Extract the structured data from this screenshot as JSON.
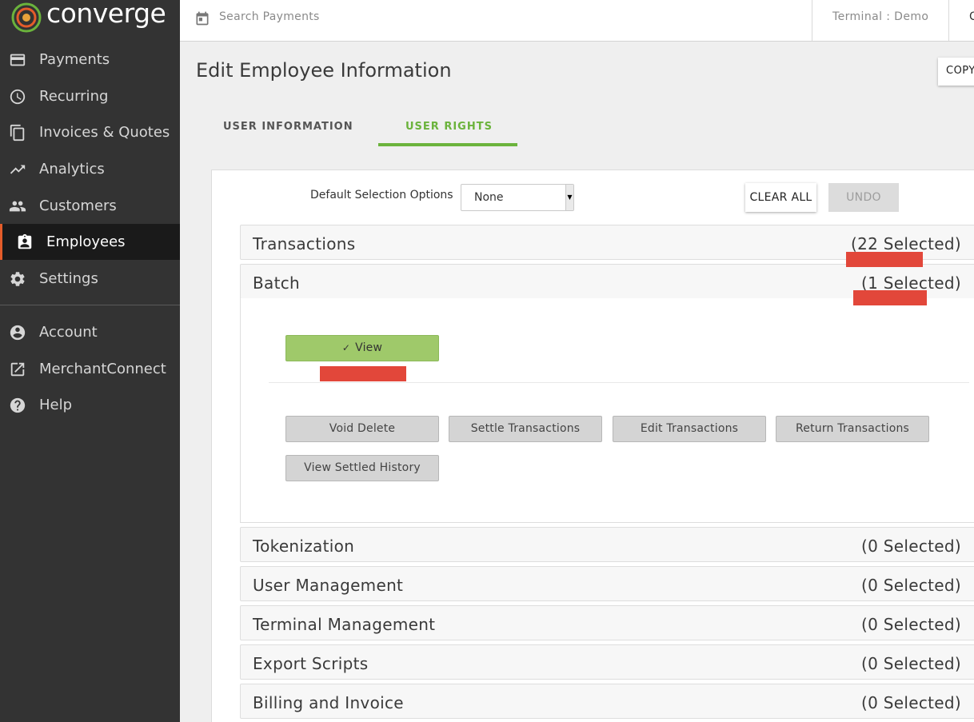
{
  "app": {
    "logo_text": "converge"
  },
  "sidebar": {
    "items": [
      {
        "label": "Payments",
        "icon": "credit-card-icon"
      },
      {
        "label": "Recurring",
        "icon": "clock-icon"
      },
      {
        "label": "Invoices & Quotes",
        "icon": "copy-icon"
      },
      {
        "label": "Analytics",
        "icon": "trending-up-icon"
      },
      {
        "label": "Customers",
        "icon": "people-icon"
      },
      {
        "label": "Employees",
        "icon": "badge-icon",
        "active": true
      },
      {
        "label": "Settings",
        "icon": "gear-icon"
      },
      {
        "label": "Account",
        "icon": "account-circle-icon"
      },
      {
        "label": "MerchantConnect",
        "icon": "external-link-icon"
      },
      {
        "label": "Help",
        "icon": "help-circle-icon"
      }
    ]
  },
  "topbar": {
    "search_placeholder": "Search Payments",
    "terminal": "Terminal : Demo",
    "more": "C"
  },
  "page": {
    "title": "Edit Employee Information",
    "copy_label": "COPY",
    "tabs": [
      {
        "label": "USER INFORMATION",
        "active": false
      },
      {
        "label": "USER RIGHTS",
        "active": true
      }
    ]
  },
  "rights": {
    "default_selection_label": "Default Selection Options",
    "default_selection_value": "None",
    "clear_all_label": "CLEAR ALL",
    "undo_label": "UNDO",
    "sections": [
      {
        "title": "Transactions",
        "count": "(22 Selected)"
      },
      {
        "title": "Batch",
        "count": "(1 Selected)",
        "expanded": true
      },
      {
        "title": "Tokenization",
        "count": "(0 Selected)"
      },
      {
        "title": "User Management",
        "count": "(0 Selected)"
      },
      {
        "title": "Terminal Management",
        "count": "(0 Selected)"
      },
      {
        "title": "Export Scripts",
        "count": "(0 Selected)"
      },
      {
        "title": "Billing and Invoice",
        "count": "(0 Selected)"
      }
    ],
    "batch_permissions": {
      "selected": [
        {
          "label": "View"
        }
      ],
      "available": [
        {
          "label": "Void Delete"
        },
        {
          "label": "Settle Transactions"
        },
        {
          "label": "Edit Transactions"
        },
        {
          "label": "Return Transactions"
        },
        {
          "label": "View Settled History"
        }
      ]
    }
  },
  "colors": {
    "sidebar_bg": "#333333",
    "accent_green": "#6bb33c",
    "selected_permission": "#9fc96a",
    "highlight_red": "#e2473a"
  }
}
